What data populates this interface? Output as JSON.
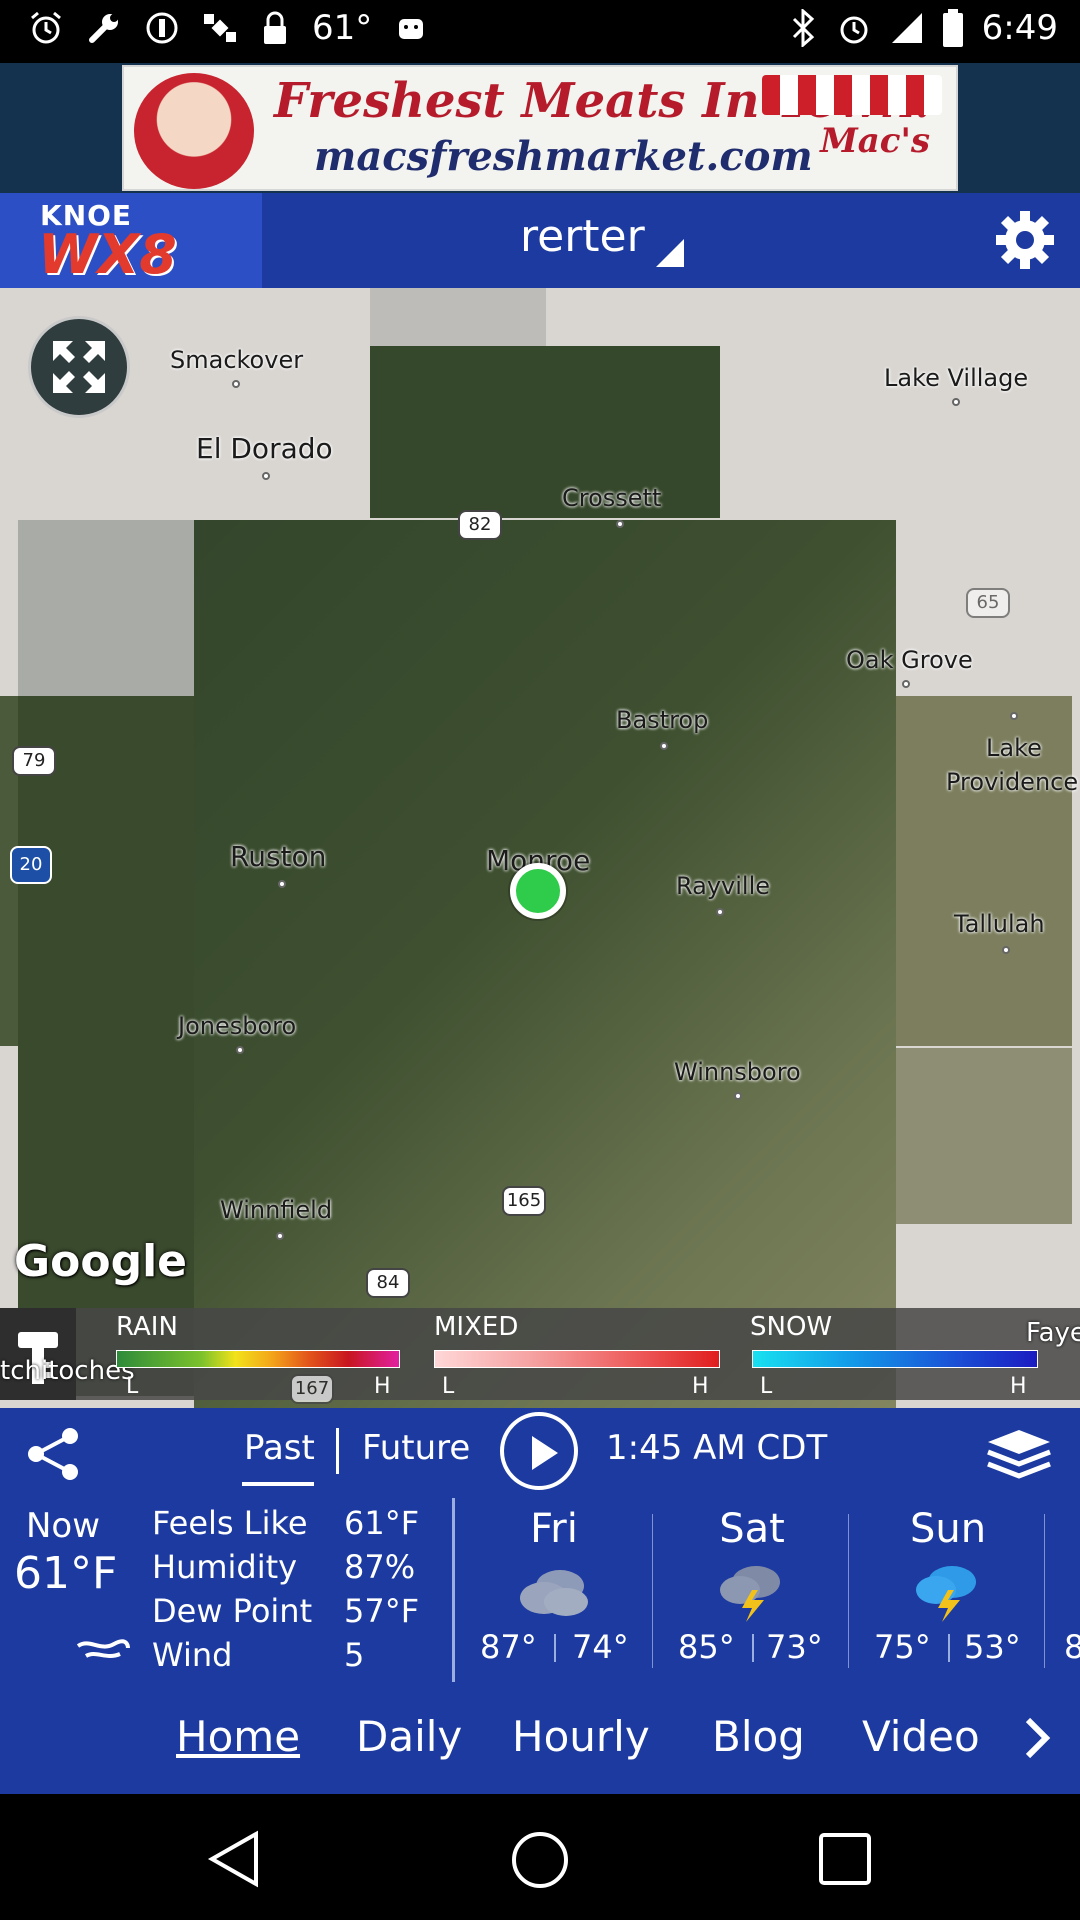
{
  "status_bar": {
    "left_icons": [
      "alarm-icon",
      "wrench-icon",
      "info-icon",
      "satellite-icon",
      "lock-icon"
    ],
    "temperature": "61°",
    "right_icons": [
      "bluetooth-icon",
      "alarm-icon",
      "signal-icon",
      "battery-icon"
    ],
    "time": "6:49"
  },
  "ad": {
    "headline": "Freshest Meats In Town!",
    "url": "macsfreshmarket.com",
    "brand": "Mac's"
  },
  "header": {
    "logo_line1": "KNOE",
    "logo_line2": "WX8",
    "location": "rerter"
  },
  "map": {
    "places": [
      "Smackover",
      "El Dorado",
      "Crossett",
      "Lake Village",
      "Oak Grove",
      "Bastrop",
      "Lake",
      "Providence",
      "Ruston",
      "Monroe",
      "Rayville",
      "Tallulah",
      "Jonesboro",
      "Winnsboro",
      "Winnfield",
      "Faye",
      "tchitoches"
    ],
    "shields": [
      "82",
      "65",
      "79",
      "20",
      "165",
      "84",
      "167"
    ],
    "attribution": "Google"
  },
  "legend": {
    "rain_label": "RAIN",
    "mixed_label": "MIXED",
    "snow_label": "SNOW",
    "low": "L",
    "high": "H",
    "colors": {
      "rain": [
        "#2e8b3a",
        "#7cc22c",
        "#f2e21a",
        "#f3a41a",
        "#e2541a",
        "#c8161f",
        "#e21fa0"
      ],
      "mixed": [
        "#ffd7d7",
        "#f5a0a0",
        "#ee5c5c",
        "#e01e1e"
      ],
      "snow": [
        "#18e1f0",
        "#1299e8",
        "#1a52d6",
        "#1b1bc0"
      ]
    }
  },
  "controls": {
    "past": "Past",
    "future": "Future",
    "time": "1:45 AM CDT"
  },
  "current": {
    "now_label": "Now",
    "temp": "61°F",
    "stats": [
      {
        "label": "Feels Like",
        "value": "61°F"
      },
      {
        "label": "Humidity",
        "value": "87%"
      },
      {
        "label": "Dew Point",
        "value": "57°F"
      },
      {
        "label": "Wind",
        "value": "5"
      }
    ]
  },
  "forecast": [
    {
      "day": "Fri",
      "icon": "cloudy-icon",
      "hi": "87°",
      "lo": "74°"
    },
    {
      "day": "Sat",
      "icon": "thunderstorm-icon",
      "hi": "85°",
      "lo": "73°"
    },
    {
      "day": "Sun",
      "icon": "thunderstorm-icon",
      "hi": "75°",
      "lo": "53°"
    },
    {
      "day": "",
      "icon": "",
      "hi": "8",
      "lo": ""
    }
  ],
  "nav": {
    "items": [
      "Home",
      "Daily",
      "Hourly",
      "Blog",
      "Video"
    ],
    "active": "Home"
  }
}
